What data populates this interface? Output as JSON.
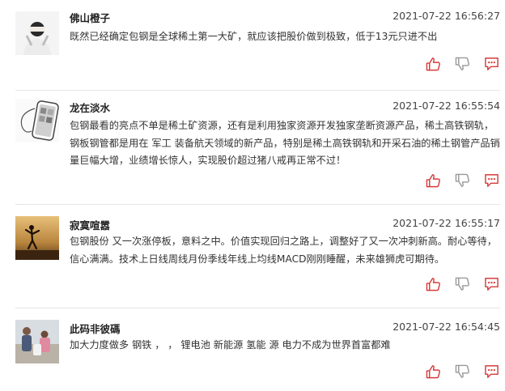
{
  "colors": {
    "action_red": "#d63a3a",
    "action_gray": "#999999",
    "divider": "#e6e6e6"
  },
  "posts": [
    {
      "username": "佛山橙子",
      "time": "2021-07-22 16:56:27",
      "content": "既然已经确定包钢是全球稀土第一大矿，就应该把股价做到极致，低于13元只进不出",
      "actions": [
        "like-icon",
        "dislike-icon",
        "comment-icon"
      ]
    },
    {
      "username": "龙在淡水",
      "time": "2021-07-22 16:55:54",
      "content": "包钢最看的亮点不单是稀土矿资源，还有是利用独家资源开发独家垄断资源产品，稀土高铁钢轨，钢板钢管都是用在 军工 装备航天领域的新产品，特别是稀土高铁钢轨和开采石油的稀土钢管产品销量巨幅大增，业绩增长惊人，实现股价超过猪八戒再正常不过！",
      "actions": [
        "like-icon",
        "dislike-icon",
        "comment-icon"
      ]
    },
    {
      "username": "寂寞喧嚣",
      "time": "2021-07-22 16:55:17",
      "content": "包钢股份 又一次涨停板，意料之中。价值实现回归之路上，调整好了又一次冲刺新高。耐心等待，信心满满。技术上日线周线月份季线年线上均线MACD刚刚睡醒，未来雄狮虎可期待。",
      "actions": [
        "like-icon",
        "dislike-icon",
        "comment-icon"
      ]
    },
    {
      "username": "此码非彼碼",
      "time": "2021-07-22 16:54:45",
      "content": "加大力度做多 钢铁 ， ， 锂电池 新能源 氢能 源 电力不成为世界首富都难",
      "actions": [
        "like-icon",
        "dislike-icon",
        "comment-icon"
      ]
    }
  ]
}
